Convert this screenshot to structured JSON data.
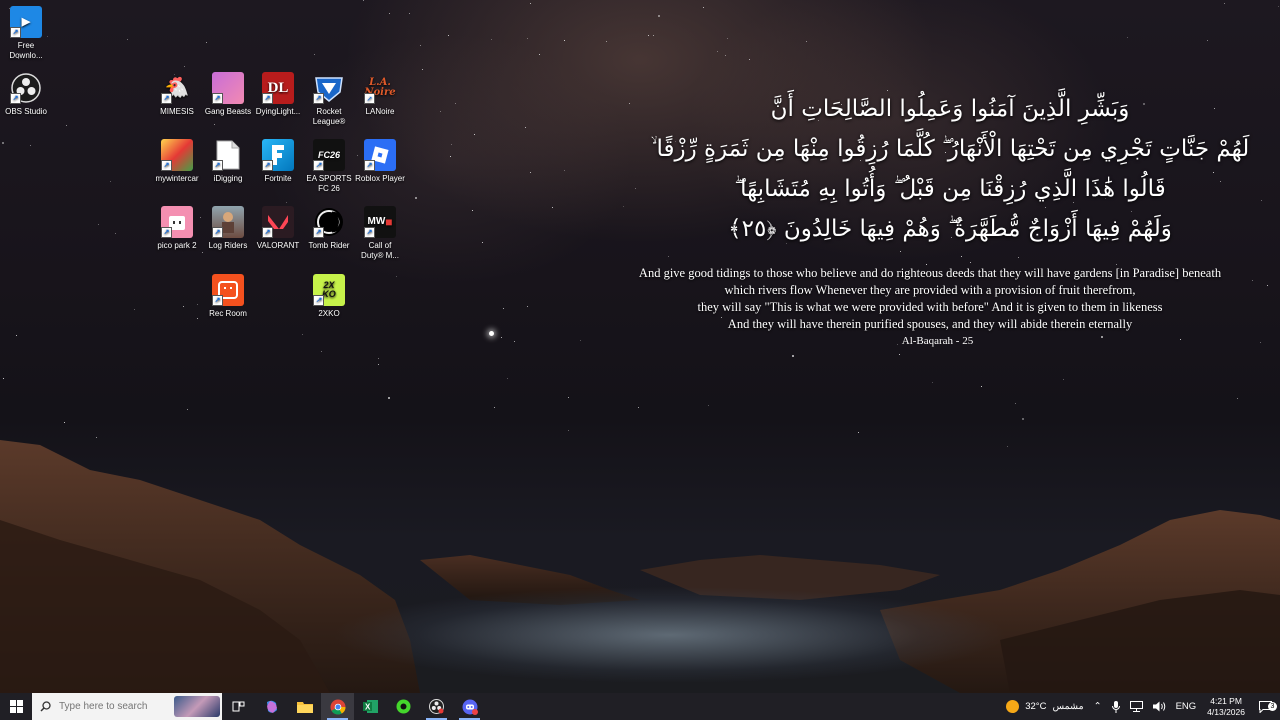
{
  "desktop": {
    "icons": [
      {
        "label": "Free\nDownlo...",
        "icon": "free-download-manager-icon"
      },
      {
        "label": "OBS Studio",
        "icon": "obs-studio-icon"
      },
      {
        "label": "MIMESIS",
        "icon": "mimesis-icon"
      },
      {
        "label": "Gang Beasts",
        "icon": "gang-beasts-icon"
      },
      {
        "label": "DyingLight...",
        "icon": "dying-light-icon"
      },
      {
        "label": "Rocket\nLeague®",
        "icon": "rocket-league-icon"
      },
      {
        "label": "LANoire",
        "icon": "la-noire-icon"
      },
      {
        "label": "mywintercar",
        "icon": "my-winter-car-icon"
      },
      {
        "label": "iDigging",
        "icon": "idigging-icon"
      },
      {
        "label": "Fortnite",
        "icon": "fortnite-icon"
      },
      {
        "label": "EA SPORTS\nFC 26",
        "icon": "ea-sports-fc-icon"
      },
      {
        "label": "Roblox Player",
        "icon": "roblox-icon"
      },
      {
        "label": "pico park 2",
        "icon": "pico-park-icon"
      },
      {
        "label": "Log Riders",
        "icon": "log-riders-icon"
      },
      {
        "label": "VALORANT",
        "icon": "valorant-icon"
      },
      {
        "label": "Tomb Rider",
        "icon": "tomb-raider-icon"
      },
      {
        "label": "Call of\nDuty® M...",
        "icon": "call-of-duty-icon"
      },
      {
        "label": "Rec Room",
        "icon": "rec-room-icon"
      },
      {
        "label": "2XKO",
        "icon": "2xko-icon"
      }
    ],
    "tile_glyphs": {
      "mimesis": "🐔",
      "dying_light": "DL",
      "la_noire": "L.A.\nNoire",
      "ea_fc": "FC26",
      "mw": "MW",
      "xko": "2X\nKO",
      "logo_free_download": "▶"
    }
  },
  "wallpaper": {
    "arabic_lines": [
      "وَبَشِّرِ الَّذِينَ آمَنُوا وَعَمِلُوا الصَّالِحَاتِ أَنَّ",
      "لَهُمْ جَنَّاتٍ تَجْرِي مِن تَحْتِهَا الْأَنْهَارُ ۖ كُلَّمَا رُزِقُوا مِنْهَا مِن ثَمَرَةٍ رِّزْقًا ۙ",
      "قَالُوا هَٰذَا الَّذِي رُزِقْنَا مِن قَبْلُ ۖ وَأُتُوا بِهِ مُتَشَابِهًا ۖ",
      "وَلَهُمْ فِيهَا أَزْوَاجٌ مُّطَهَّرَةٌ ۖ وَهُمْ فِيهَا خَالِدُونَ ﴿٢٥﴾"
    ],
    "english_lines": [
      "And give good tidings to those who believe and do righteous deeds that they will have gardens [in Paradise] beneath",
      "which rivers flow Whenever they are provided with a provision of fruit therefrom,",
      "they will say \"This is what we were provided with before\" And it is given to them in likeness",
      "And they will have therein purified spouses, and they will abide therein eternally"
    ],
    "reference": "Al-Baqarah - 25"
  },
  "taskbar": {
    "search_placeholder": "Type here to search",
    "apps": [
      {
        "name": "task-view-icon"
      },
      {
        "name": "copilot-icon"
      },
      {
        "name": "file-explorer-icon"
      },
      {
        "name": "chrome-icon"
      },
      {
        "name": "excel-icon"
      },
      {
        "name": "razer-icon"
      },
      {
        "name": "obs-taskbar-icon"
      },
      {
        "name": "discord-icon"
      }
    ],
    "weather_temp": "32°C",
    "weather_desc": "مشمس",
    "language": "ENG",
    "time": "4:21 PM",
    "date": "4/13/2026",
    "notification_count": "3",
    "colors": {
      "taskbar": "#201f25",
      "search_bg": "#f3f3f3"
    }
  }
}
